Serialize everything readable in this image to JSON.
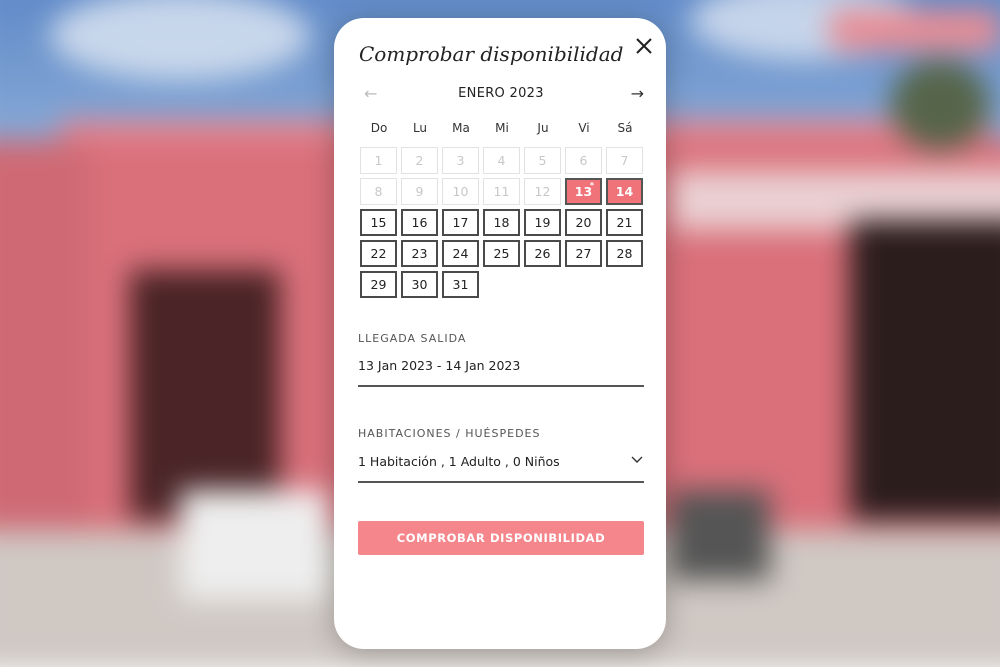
{
  "modal": {
    "title": "Comprobar disponibilidad",
    "close_icon": "close-icon"
  },
  "calendar": {
    "prev_icon": "arrow-left-icon",
    "next_icon": "arrow-right-icon",
    "month_label": "ENERO 2023",
    "weekdays": [
      "Do",
      "Lu",
      "Ma",
      "Mi",
      "Ju",
      "Vi",
      "Sá"
    ],
    "days": [
      {
        "label": "1",
        "state": "disabled"
      },
      {
        "label": "2",
        "state": "disabled"
      },
      {
        "label": "3",
        "state": "disabled"
      },
      {
        "label": "4",
        "state": "disabled"
      },
      {
        "label": "5",
        "state": "disabled"
      },
      {
        "label": "6",
        "state": "disabled"
      },
      {
        "label": "7",
        "state": "disabled"
      },
      {
        "label": "8",
        "state": "disabled"
      },
      {
        "label": "9",
        "state": "disabled"
      },
      {
        "label": "10",
        "state": "disabled"
      },
      {
        "label": "11",
        "state": "disabled"
      },
      {
        "label": "12",
        "state": "disabled"
      },
      {
        "label": "13",
        "state": "selected",
        "marker": "*"
      },
      {
        "label": "14",
        "state": "selected"
      },
      {
        "label": "15",
        "state": "available"
      },
      {
        "label": "16",
        "state": "available"
      },
      {
        "label": "17",
        "state": "available"
      },
      {
        "label": "18",
        "state": "available"
      },
      {
        "label": "19",
        "state": "available"
      },
      {
        "label": "20",
        "state": "available"
      },
      {
        "label": "21",
        "state": "available"
      },
      {
        "label": "22",
        "state": "available"
      },
      {
        "label": "23",
        "state": "available"
      },
      {
        "label": "24",
        "state": "available"
      },
      {
        "label": "25",
        "state": "available"
      },
      {
        "label": "26",
        "state": "available"
      },
      {
        "label": "27",
        "state": "available"
      },
      {
        "label": "28",
        "state": "available"
      },
      {
        "label": "29",
        "state": "available"
      },
      {
        "label": "30",
        "state": "available"
      },
      {
        "label": "31",
        "state": "available"
      }
    ]
  },
  "dates": {
    "label": "LLEGADA SALIDA",
    "value": "13 Jan 2023 - 14 Jan 2023"
  },
  "guests": {
    "label": "HABITACIONES / HUÉSPEDES",
    "value": "1 Habitación , 1 Adulto , 0 Niños",
    "dropdown_icon": "chevron-down-icon"
  },
  "submit_label": "COMPROBAR DISPONIBILIDAD",
  "colors": {
    "accent": "#f4868c",
    "selected_day": "#f0737a"
  }
}
